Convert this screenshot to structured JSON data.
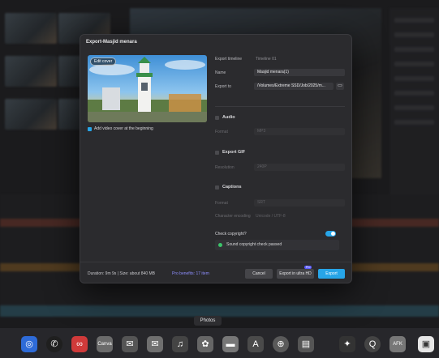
{
  "dialog": {
    "title": "Export-Masjid menara",
    "edit_cover": "Edit cover",
    "add_cover_label": "Add video cover at the beginning",
    "export_timeline_label": "Export timeline",
    "export_timeline_value": "Timeline 01",
    "name_label": "Name",
    "name_value": "Masjid menara(1)",
    "export_to_label": "Export to",
    "export_to_value": "/Volumes/Extreme SSD/Job/2025/m...",
    "audio": {
      "title": "Audio",
      "format_label": "Format",
      "format_value": "MP3"
    },
    "gif": {
      "title": "Export GIF",
      "resolution_label": "Resolution",
      "resolution_value": "240P"
    },
    "captions": {
      "title": "Captions",
      "format_label": "Format",
      "format_value": "SRT",
      "encoding_label": "Character encoding",
      "encoding_value": "Unicode / UTF-8"
    },
    "copyright_label": "Check copyright?",
    "copyright_passed": "Sound copyright check passed",
    "footer": {
      "duration": "Duration: 9m 9s | Size: about 840 MB",
      "pro_benefits": "Pro benefits: 17 item",
      "cancel": "Cancel",
      "export_ultra": "Export in ultra HD",
      "export": "Export",
      "pro_badge": "Pro"
    }
  },
  "dock": {
    "tooltip": "Photos",
    "apps": [
      "safari-icon",
      "whatsapp-icon",
      "creative-cloud-icon",
      "canva-icon",
      "mail-icon",
      "messages-icon",
      "music-icon",
      "settings-icon",
      "finder-icon",
      "appstore-icon",
      "chrome-icon",
      "notes-icon",
      "bulb-icon",
      "quicktime-icon",
      "afk-icon",
      "preview-icon"
    ],
    "canva_label": "Canva",
    "afk_label": "AFK"
  },
  "colors": {
    "accent": "#27a5e8",
    "dialog_bg": "#2b2b2e"
  }
}
